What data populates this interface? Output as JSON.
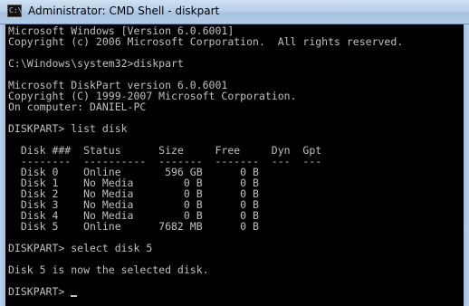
{
  "window": {
    "title": "Administrator: CMD Shell - diskpart",
    "icon": "cmd-icon",
    "icon_glyph": "C:\\"
  },
  "console": {
    "lines": [
      "Microsoft Windows [Version 6.0.6001]",
      "Copyright (c) 2006 Microsoft Corporation.  All rights reserved.",
      "",
      "C:\\Windows\\system32>diskpart",
      "",
      "Microsoft DiskPart version 6.0.6001",
      "Copyright (C) 1999-2007 Microsoft Corporation.",
      "On computer: DANIEL-PC",
      "",
      "DISKPART> list disk",
      "",
      "  Disk ###  Status      Size     Free     Dyn  Gpt",
      "  --------  ----------  -------  -------  ---  ---",
      "  Disk 0    Online       596 GB      0 B",
      "  Disk 1    No Media        0 B      0 B",
      "  Disk 2    No Media        0 B      0 B",
      "  Disk 3    No Media        0 B      0 B",
      "  Disk 4    No Media        0 B      0 B",
      "  Disk 5    Online      7682 MB      0 B",
      "",
      "DISKPART> select disk 5",
      "",
      "Disk 5 is now the selected disk.",
      "",
      "DISKPART> "
    ]
  },
  "colors": {
    "console_background": "#000000",
    "console_text": "#c0c0c0",
    "titlebar": "#b8cfe8"
  }
}
